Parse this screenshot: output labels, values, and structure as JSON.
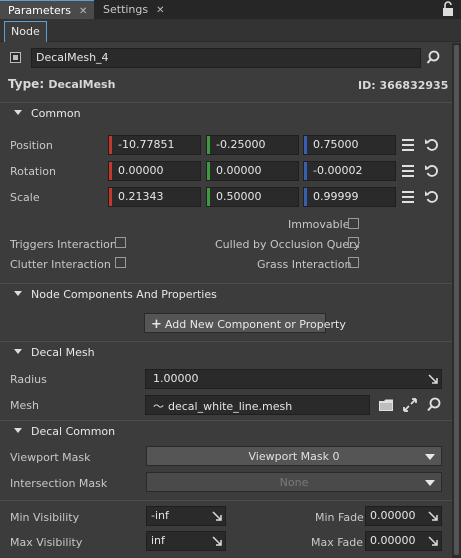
{
  "tabs": [
    {
      "label": "Parameters",
      "close": "✕"
    },
    {
      "label": "Settings",
      "close": "✕"
    }
  ],
  "subtab": "Node",
  "node": {
    "name": "DecalMesh_4",
    "type_label": "Type:",
    "type_value": "DecalMesh",
    "id_label": "ID:",
    "id_value": "366832935"
  },
  "common": {
    "title": "Common",
    "position": {
      "label": "Position",
      "x": "-10.77851",
      "y": "-0.25000",
      "z": "0.75000"
    },
    "rotation": {
      "label": "Rotation",
      "x": "0.00000",
      "y": "0.00000",
      "z": "-0.00002"
    },
    "scale": {
      "label": "Scale",
      "x": "0.21343",
      "y": "0.50000",
      "z": "0.99999"
    },
    "immovable": "Immovable",
    "triggers_interaction": "Triggers Interaction",
    "culled_by_occlusion": "Culled by Occlusion Query",
    "clutter_interaction": "Clutter Interaction",
    "grass_interaction": "Grass Interaction"
  },
  "components": {
    "title": "Node Components And Properties",
    "add_button": "Add New Component or Property"
  },
  "decal_mesh": {
    "title": "Decal Mesh",
    "radius_label": "Radius",
    "radius_value": "1.00000",
    "mesh_label": "Mesh",
    "mesh_value": "decal_white_line.mesh"
  },
  "decal_common": {
    "title": "Decal Common",
    "viewport_mask_label": "Viewport Mask",
    "viewport_mask_value": "Viewport Mask 0",
    "intersection_mask_label": "Intersection Mask",
    "intersection_mask_value": "None",
    "min_visibility_label": "Min Visibility",
    "min_visibility_value": "-inf",
    "max_visibility_label": "Max Visibility",
    "max_visibility_value": "inf",
    "min_fade_label": "Min Fade",
    "min_fade_value": "0.00000",
    "max_fade_label": "Max Fade",
    "max_fade_value": "0.00000"
  },
  "colors": {
    "x_axis": "#c0392b",
    "y_axis": "#3d9a3d",
    "z_axis": "#3b5fb0",
    "accent": "#5aa0d8"
  }
}
